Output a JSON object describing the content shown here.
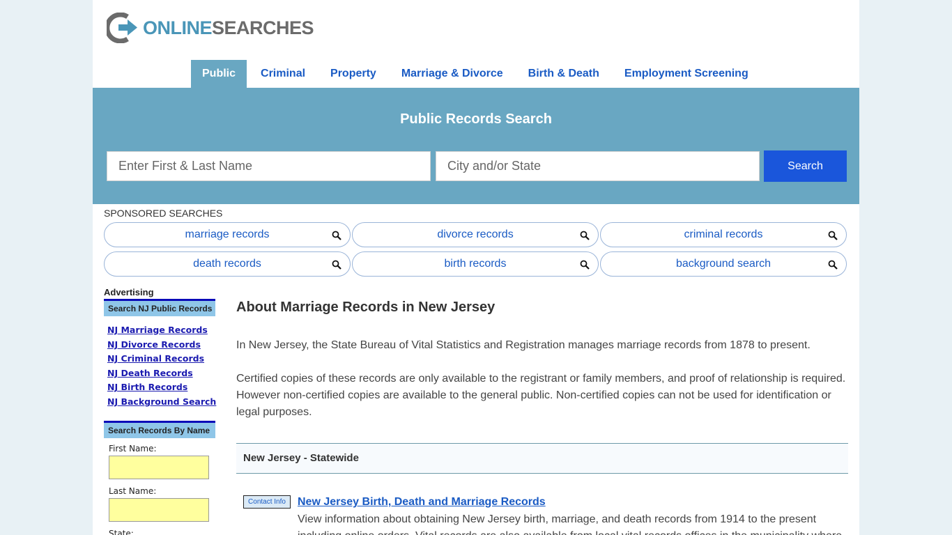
{
  "brand": {
    "part1": "ONLINE",
    "part2": "SEARCHES",
    "colors": {
      "accent": "#4a96b8",
      "grey": "#6b6b6b",
      "hero": "#69a7c2",
      "button": "#1a56db",
      "link": "#1a5bc4"
    }
  },
  "nav": {
    "items": [
      {
        "label": "Public",
        "active": true
      },
      {
        "label": "Criminal"
      },
      {
        "label": "Property"
      },
      {
        "label": "Marriage & Divorce"
      },
      {
        "label": "Birth & Death"
      },
      {
        "label": "Employment Screening"
      }
    ]
  },
  "hero": {
    "title": "Public Records Search",
    "name_placeholder": "Enter First & Last Name",
    "city_placeholder": "City and/or State",
    "search_label": "Search"
  },
  "sponsored": {
    "label": "SPONSORED SEARCHES",
    "items": [
      "marriage records",
      "divorce records",
      "criminal records",
      "death records",
      "birth records",
      "background search"
    ],
    "icon": "magnifier-icon"
  },
  "sidebar": {
    "advertising": "Advertising",
    "records_heading": "Search NJ Public Records",
    "links": [
      "NJ Marriage Records",
      "NJ Divorce Records",
      "NJ Criminal Records",
      "NJ Death Records",
      "NJ Birth Records",
      "NJ Background Search"
    ],
    "name_heading": "Search Records By Name",
    "first_name_label": "First Name:",
    "last_name_label": "Last Name:",
    "state_label": "State:"
  },
  "main": {
    "title": "About Marriage Records in New Jersey",
    "p1": "In New Jersey, the State Bureau of Vital Statistics and Registration manages marriage records from 1878 to present.",
    "p2": "Certified copies of these records are only available to the registrant or family members, and proof of relationship is required. However non-certified copies are available to the general public. Non-certified copies can not be used for identification or legal purposes.",
    "region": "New Jersey - Statewide",
    "entry": {
      "contact_label": "Contact Info",
      "title": "New Jersey Birth, Death and Marriage Records",
      "desc": "View information about obtaining New Jersey birth, marriage, and death records from 1914 to the present including online orders. Vital records are also available from local vital records offices in the municipality where"
    }
  }
}
